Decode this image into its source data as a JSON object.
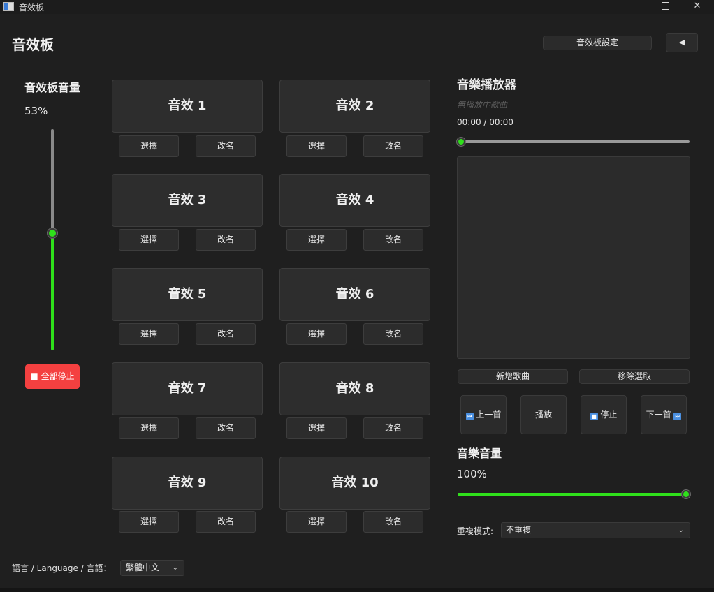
{
  "window": {
    "title": "音效板"
  },
  "header": {
    "title": "音效板",
    "settings_label": "音效板設定",
    "back_label": "◀"
  },
  "soundboard_volume": {
    "label": "音效板音量",
    "value_text": "53%",
    "level": 0.53
  },
  "stop_all_label": "■ 全部停止",
  "pads": [
    {
      "label": "音效 1",
      "select_label": "選擇",
      "rename_label": "改名"
    },
    {
      "label": "音效 2",
      "select_label": "選擇",
      "rename_label": "改名"
    },
    {
      "label": "音效 3",
      "select_label": "選擇",
      "rename_label": "改名"
    },
    {
      "label": "音效 4",
      "select_label": "選擇",
      "rename_label": "改名"
    },
    {
      "label": "音效 5",
      "select_label": "選擇",
      "rename_label": "改名"
    },
    {
      "label": "音效 6",
      "select_label": "選擇",
      "rename_label": "改名"
    },
    {
      "label": "音效 7",
      "select_label": "選擇",
      "rename_label": "改名"
    },
    {
      "label": "音效 8",
      "select_label": "選擇",
      "rename_label": "改名"
    },
    {
      "label": "音效 9",
      "select_label": "選擇",
      "rename_label": "改名"
    },
    {
      "label": "音效 10",
      "select_label": "選擇",
      "rename_label": "改名"
    }
  ],
  "music_player": {
    "title": "音樂播放器",
    "now_playing": "無播放中歌曲",
    "time": "00:00 / 00:00",
    "progress": 0.0,
    "add_song_label": "新增歌曲",
    "remove_selected_label": "移除選取",
    "prev_label": "上一首",
    "play_label": "播放",
    "stop_label": "停止",
    "next_label": "下一首",
    "volume_label": "音樂音量",
    "volume_text": "100%",
    "volume_level": 1.0,
    "repeat_label": "重複模式:",
    "repeat_value": "不重複"
  },
  "language": {
    "label": "語言 / Language / 言語：",
    "value": "繁體中文"
  },
  "colors": {
    "accent_green": "#2fe01b",
    "stop_red": "#f44040",
    "prev_next_icon_blue": "#4a8fe0"
  }
}
